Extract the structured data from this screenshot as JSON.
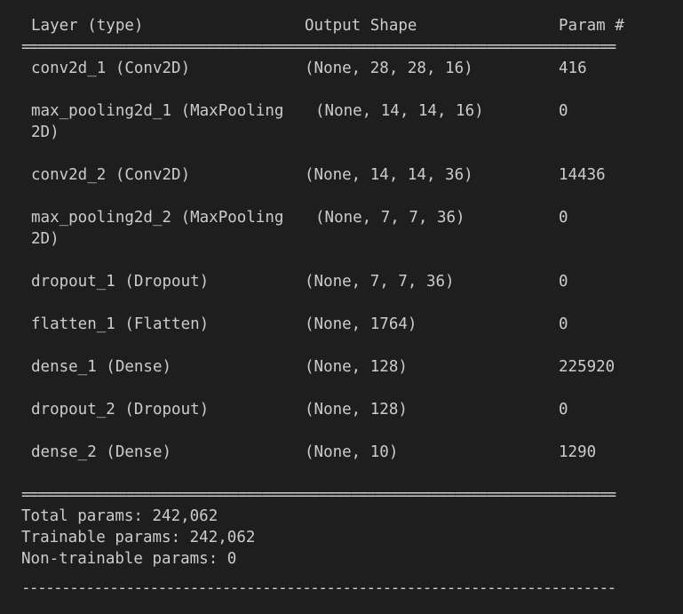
{
  "header": {
    "layer_col": "Layer (type)",
    "shape_col": "Output Shape",
    "param_col": "Param #"
  },
  "separator_double": "==========================================================================",
  "separator_single": "--------------------------------------------------------------------------",
  "rows": [
    {
      "layer": "conv2d_1 (Conv2D)",
      "layer_cont": "",
      "shape": "(None, 28, 28, 16)",
      "params": "416"
    },
    {
      "layer": "max_pooling2d_1 (MaxPooling",
      "layer_cont": "2D)",
      "shape": "(None, 14, 14, 16)",
      "params": "0"
    },
    {
      "layer": "conv2d_2 (Conv2D)",
      "layer_cont": "",
      "shape": "(None, 14, 14, 36)",
      "params": "14436"
    },
    {
      "layer": "max_pooling2d_2 (MaxPooling",
      "layer_cont": "2D)",
      "shape": "(None, 7, 7, 36)",
      "params": "0"
    },
    {
      "layer": "dropout_1 (Dropout)",
      "layer_cont": "",
      "shape": "(None, 7, 7, 36)",
      "params": "0"
    },
    {
      "layer": "flatten_1 (Flatten)",
      "layer_cont": "",
      "shape": "(None, 1764)",
      "params": "0"
    },
    {
      "layer": "dense_1 (Dense)",
      "layer_cont": "",
      "shape": "(None, 128)",
      "params": "225920"
    },
    {
      "layer": "dropout_2 (Dropout)",
      "layer_cont": "",
      "shape": "(None, 128)",
      "params": "0"
    },
    {
      "layer": "dense_2 (Dense)",
      "layer_cont": "",
      "shape": "(None, 10)",
      "params": "1290"
    }
  ],
  "footer": {
    "total": "Total params: 242,062",
    "trainable": "Trainable params: 242,062",
    "non_trainable": "Non-trainable params: 0"
  },
  "colors": {
    "background": "#1e1e1e",
    "text": "#cccccc"
  }
}
